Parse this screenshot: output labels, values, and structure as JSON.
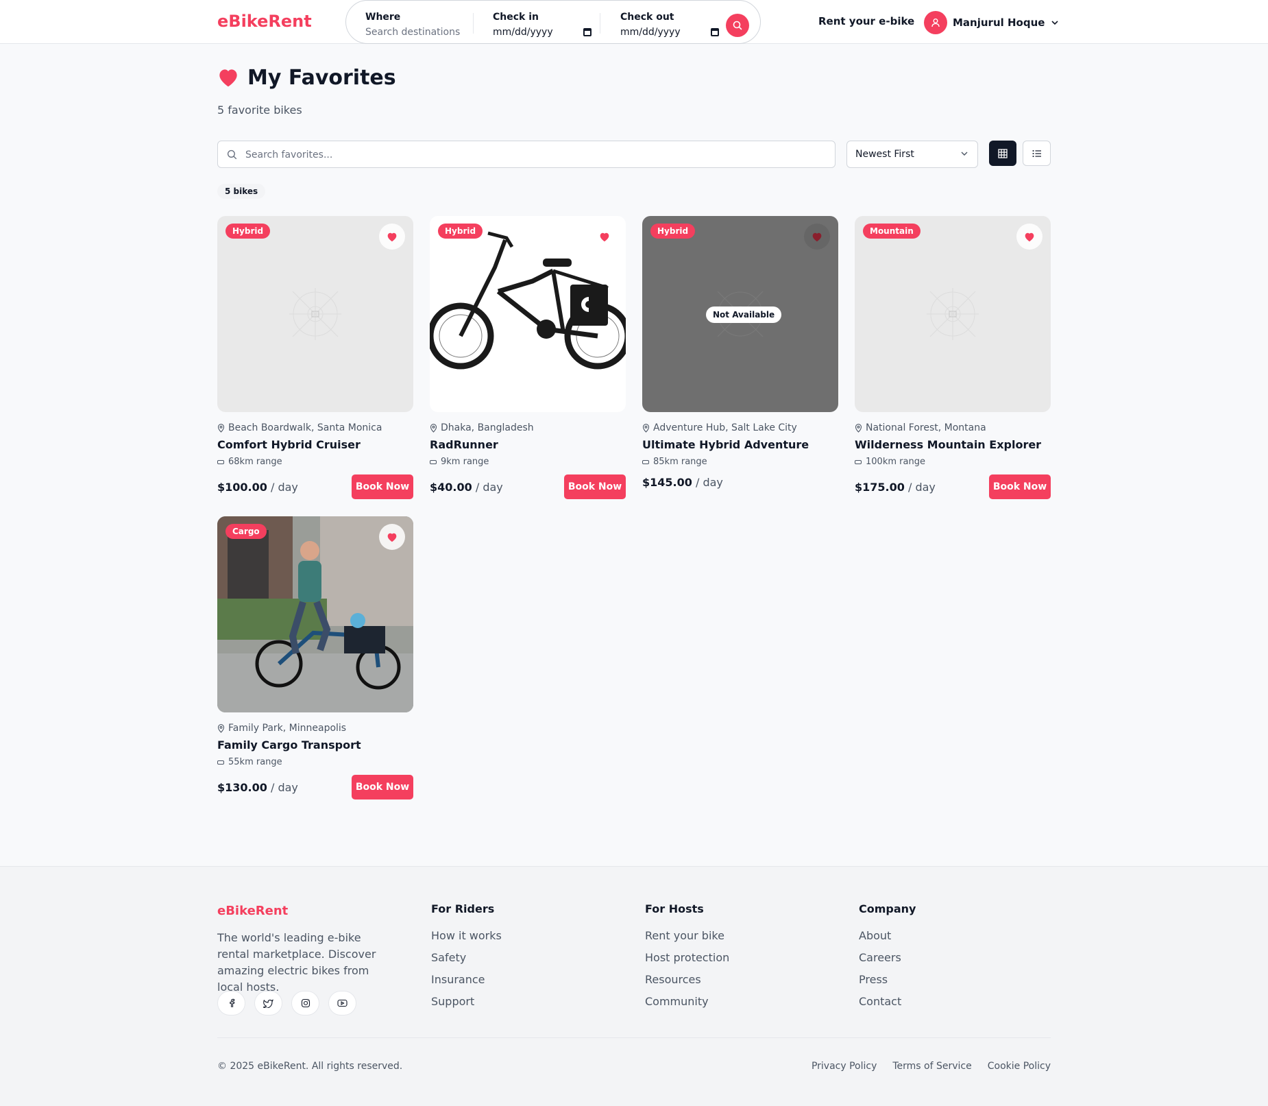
{
  "colors": {
    "brand": "#f43f5e",
    "dark": "#111827"
  },
  "header": {
    "logo": "eBikeRent",
    "where_label": "Where",
    "where_placeholder": "Search destinations",
    "checkin_label": "Check in",
    "checkin_value": "mm/dd/yyyy",
    "checkout_label": "Check out",
    "checkout_value": "mm/dd/yyyy",
    "rent_link": "Rent your e-bike",
    "user_name": "Manjurul Hoque"
  },
  "page": {
    "title": "My Favorites",
    "subtitle": "5 favorite bikes",
    "search_placeholder": "Search favorites...",
    "sort_value": "Newest First",
    "count_badge": "5 bikes"
  },
  "bikes": [
    {
      "category": "Hybrid",
      "location": "Beach Boardwalk, Santa Monica",
      "name": "Comfort Hybrid Cruiser",
      "range": "68km range",
      "price": "$100.00",
      "per": "/ day",
      "action": "Book Now"
    },
    {
      "category": "Hybrid",
      "location": "Dhaka, Bangladesh",
      "name": "RadRunner",
      "range": "9km range",
      "price": "$40.00",
      "per": "/ day",
      "action": "Book Now"
    },
    {
      "category": "Hybrid",
      "location": "Adventure Hub, Salt Lake City",
      "name": "Ultimate Hybrid Adventure",
      "range": "85km range",
      "price": "$145.00",
      "per": "/ day",
      "status": "Not Available"
    },
    {
      "category": "Mountain",
      "location": "National Forest, Montana",
      "name": "Wilderness Mountain Explorer",
      "range": "100km range",
      "price": "$175.00",
      "per": "/ day",
      "action": "Book Now"
    },
    {
      "category": "Cargo",
      "location": "Family Park, Minneapolis",
      "name": "Family Cargo Transport",
      "range": "55km range",
      "price": "$130.00",
      "per": "/ day",
      "action": "Book Now"
    }
  ],
  "footer": {
    "logo": "eBikeRent",
    "description": "The world's leading e-bike rental marketplace. Discover amazing electric bikes from local hosts.",
    "socials": [
      "facebook-icon",
      "twitter-icon",
      "instagram-icon",
      "youtube-icon"
    ],
    "columns": [
      {
        "title": "For Riders",
        "links": [
          "How it works",
          "Safety",
          "Insurance",
          "Support"
        ]
      },
      {
        "title": "For Hosts",
        "links": [
          "Rent your bike",
          "Host protection",
          "Resources",
          "Community"
        ]
      },
      {
        "title": "Company",
        "links": [
          "About",
          "Careers",
          "Press",
          "Contact"
        ]
      }
    ],
    "copyright": "© 2025 eBikeRent. All rights reserved.",
    "legal": [
      "Privacy Policy",
      "Terms of Service",
      "Cookie Policy"
    ]
  }
}
